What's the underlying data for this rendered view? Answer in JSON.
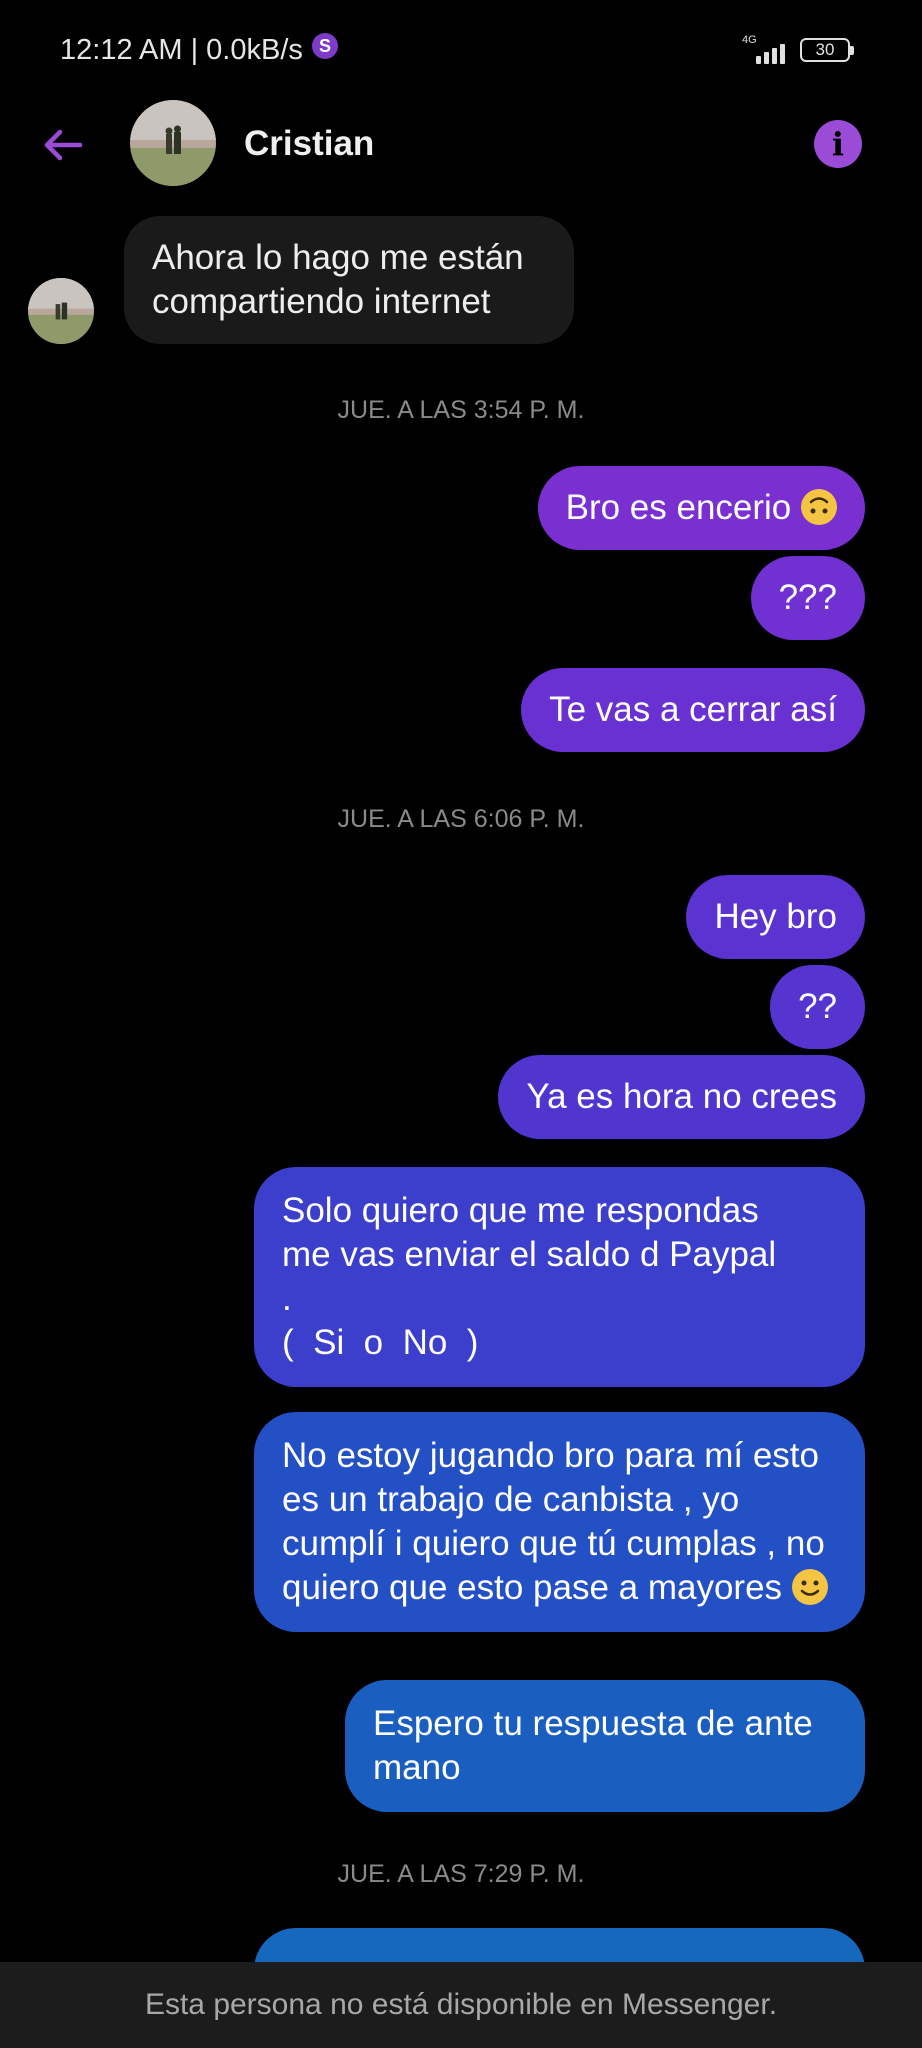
{
  "status_bar": {
    "time": "12:12 AM | 0.0kB/s",
    "app_icon": "S",
    "network": "4G",
    "battery": "30"
  },
  "header": {
    "contact_name": "Cristian",
    "back_icon": "arrow-left-icon",
    "info_icon": "info-icon"
  },
  "messages": {
    "incoming_1": "Ahora lo hago me están compartiendo internet",
    "ts_1": "JUE. A LAS 3:54 P. M.",
    "out_1": "Bro es encerio",
    "out_2": "???",
    "out_3": "Te vas a cerrar así",
    "ts_2": "JUE. A LAS 6:06 P. M.",
    "out_4": "Hey bro",
    "out_5": "??",
    "out_6": "Ya es hora no crees",
    "out_7_line1": "Solo quiero que me respondas",
    "out_7_line2": "me vas enviar el saldo d Paypal",
    "out_7_line3": ".",
    "out_7_line4": "(  Si  o  No  )",
    "out_8": "No estoy jugando bro para mí esto es un trabajo de canbista , yo cumplí i quiero que tú cumplas , no quiero que esto pase a mayores",
    "out_9": "Espero tu respuesta de ante mano",
    "ts_3": "JUE. A LAS 7:29 P. M."
  },
  "footer": {
    "notice": "Esta persona no está disponible en Messenger."
  },
  "colors": {
    "accent": "#9b4cd6",
    "bubble_purple": "#7a2fd0",
    "bubble_blue": "#1a5fc0",
    "incoming_bg": "#1a1a1a"
  }
}
